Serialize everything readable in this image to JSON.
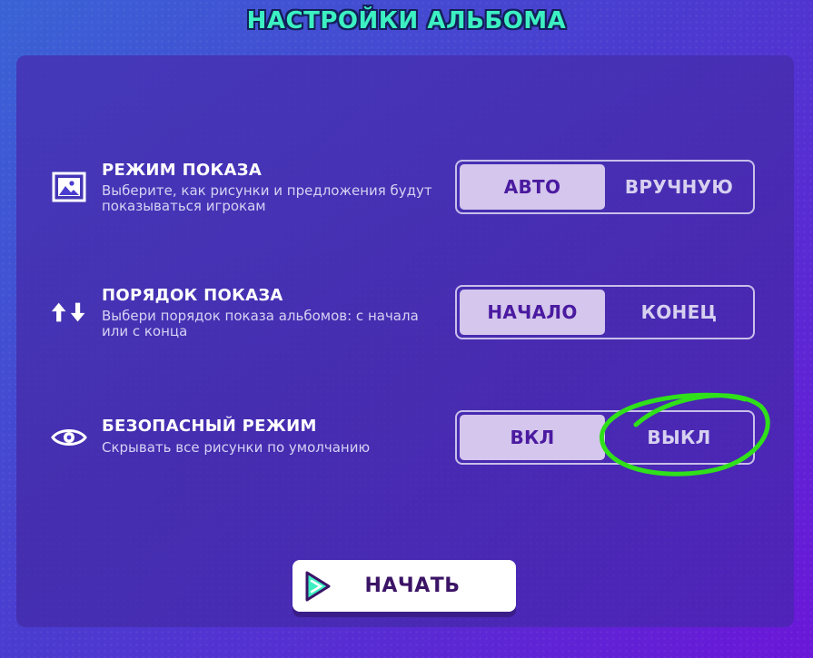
{
  "page": {
    "title": "НАСТРОЙКИ АЛЬБОМА"
  },
  "settings": [
    {
      "icon": "image-icon",
      "title": "РЕЖИМ ПОКАЗА",
      "description": "Выберите, как рисунки и предложения будут показываться игрокам",
      "options": [
        "АВТО",
        "ВРУЧНУЮ"
      ],
      "selected": "АВТО"
    },
    {
      "icon": "sort-arrows-icon",
      "title": "ПОРЯДОК ПОКАЗА",
      "description": "Выбери порядок показа альбомов: с начала или с конца",
      "options": [
        "НАЧАЛО",
        "КОНЕЦ"
      ],
      "selected": "НАЧАЛО"
    },
    {
      "icon": "eye-icon",
      "title": "БЕЗОПАСНЫЙ РЕЖИМ",
      "description": "Скрывать все рисунки по умолчанию",
      "options": [
        "ВКЛ",
        "ВЫКЛ"
      ],
      "selected": "ВКЛ"
    }
  ],
  "start_button": {
    "label": "НАЧАТЬ",
    "icon": "play-icon"
  },
  "annotation": {
    "type": "circle-highlight",
    "target": "ВЫКЛ",
    "color": "#2fe01a"
  },
  "colors": {
    "title": "#3cf0c2",
    "toggle_active_bg": "#d4c6ec",
    "toggle_active_text": "#4a1aa0",
    "toggle_inactive_text": "#d7d0f0"
  }
}
